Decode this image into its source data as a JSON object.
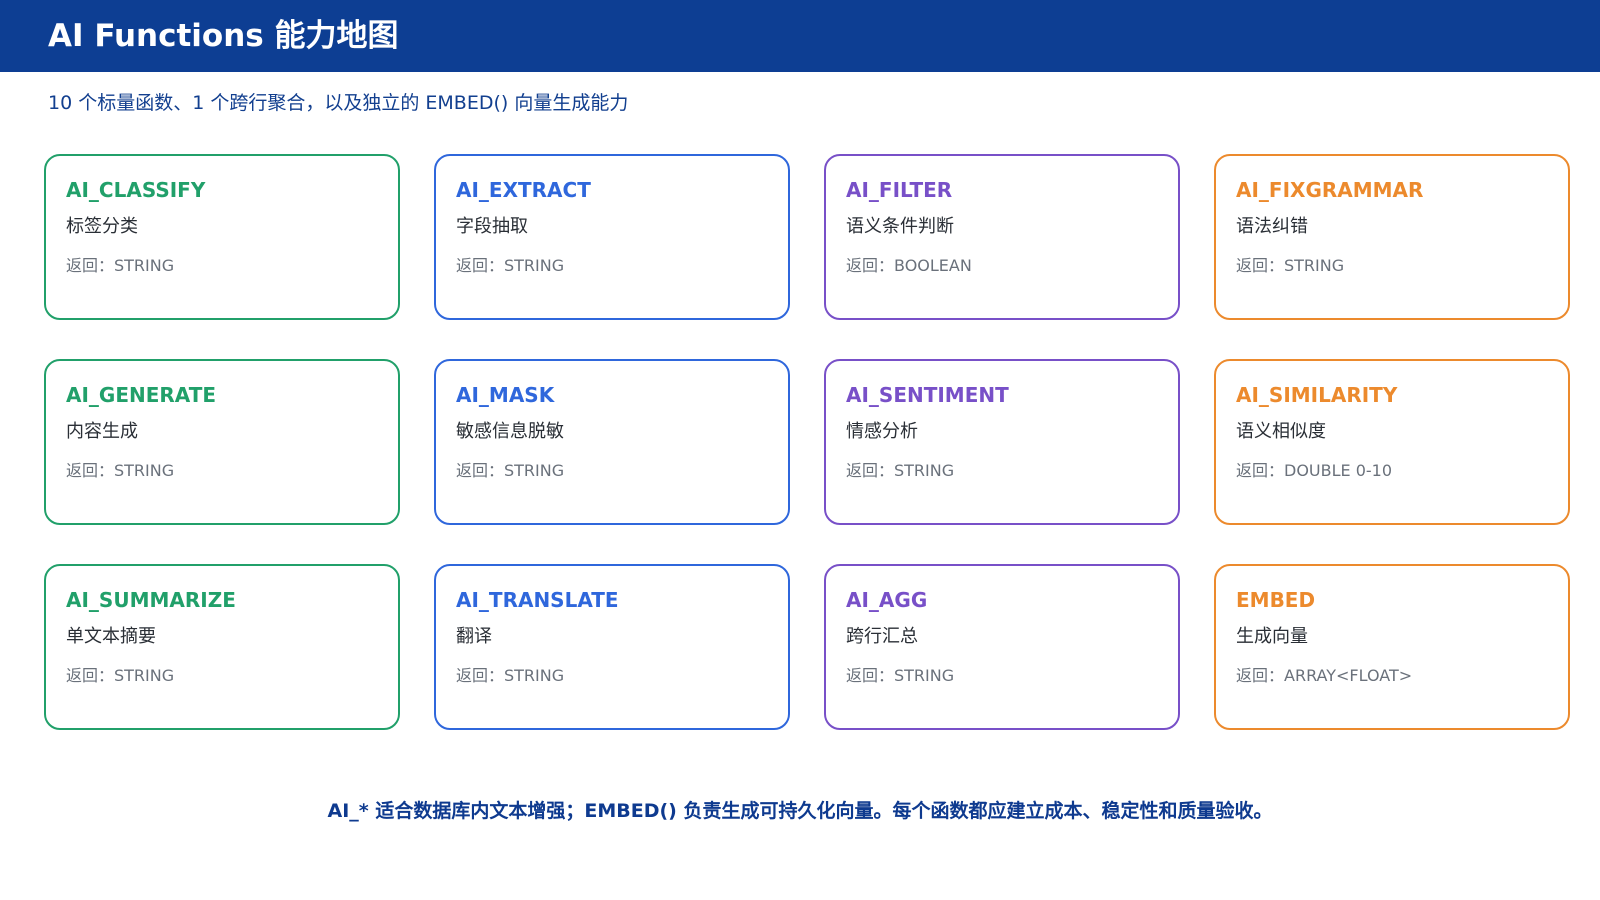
{
  "header": {
    "title": "AI Functions 能力地图"
  },
  "subtitle": "10 个标量函数、1 个跨行聚合，以及独立的 EMBED() 向量生成能力",
  "palette": {
    "green": "#21a06a",
    "blue": "#2f67dc",
    "purple": "#7850c8",
    "orange": "#ec8a2d"
  },
  "cards": [
    {
      "name": "AI_CLASSIFY",
      "desc": "标签分类",
      "ret": "返回：STRING",
      "color": "#21a06a"
    },
    {
      "name": "AI_EXTRACT",
      "desc": "字段抽取",
      "ret": "返回：STRING",
      "color": "#2f67dc"
    },
    {
      "name": "AI_FILTER",
      "desc": "语义条件判断",
      "ret": "返回：BOOLEAN",
      "color": "#7850c8"
    },
    {
      "name": "AI_FIXGRAMMAR",
      "desc": "语法纠错",
      "ret": "返回：STRING",
      "color": "#ec8a2d"
    },
    {
      "name": "AI_GENERATE",
      "desc": "内容生成",
      "ret": "返回：STRING",
      "color": "#21a06a"
    },
    {
      "name": "AI_MASK",
      "desc": "敏感信息脱敏",
      "ret": "返回：STRING",
      "color": "#2f67dc"
    },
    {
      "name": "AI_SENTIMENT",
      "desc": "情感分析",
      "ret": "返回：STRING",
      "color": "#7850c8"
    },
    {
      "name": "AI_SIMILARITY",
      "desc": "语义相似度",
      "ret": "返回：DOUBLE 0-10",
      "color": "#ec8a2d"
    },
    {
      "name": "AI_SUMMARIZE",
      "desc": "单文本摘要",
      "ret": "返回：STRING",
      "color": "#21a06a"
    },
    {
      "name": "AI_TRANSLATE",
      "desc": "翻译",
      "ret": "返回：STRING",
      "color": "#2f67dc"
    },
    {
      "name": "AI_AGG",
      "desc": "跨行汇总",
      "ret": "返回：STRING",
      "color": "#7850c8"
    },
    {
      "name": "EMBED",
      "desc": "生成向量",
      "ret": "返回：ARRAY<FLOAT>",
      "color": "#ec8a2d"
    }
  ],
  "footer": "AI_* 适合数据库内文本增强；EMBED() 负责生成可持久化向量。每个函数都应建立成本、稳定性和质量验收。"
}
